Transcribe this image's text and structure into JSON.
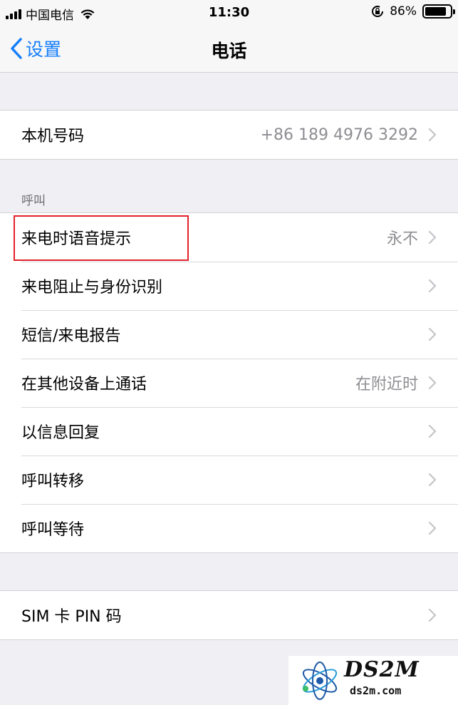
{
  "status_bar": {
    "carrier": "中国电信",
    "time": "11:30",
    "battery_percent": "86%",
    "battery_level": 0.86,
    "icons": [
      "signal-icon",
      "wifi-icon",
      "rotation-lock-icon",
      "battery-icon"
    ]
  },
  "nav": {
    "back_label": "设置",
    "title": "电话"
  },
  "my_number": {
    "label": "本机号码",
    "value": "+86 189 4976 3292"
  },
  "calls_section": {
    "header": "呼叫",
    "items": [
      {
        "label": "来电时语音提示",
        "value": "永不"
      },
      {
        "label": "来电阻止与身份识别",
        "value": ""
      },
      {
        "label": "短信/来电报告",
        "value": ""
      },
      {
        "label": "在其他设备上通话",
        "value": "在附近时"
      },
      {
        "label": "以信息回复",
        "value": ""
      },
      {
        "label": "呼叫转移",
        "value": ""
      },
      {
        "label": "呼叫等待",
        "value": ""
      }
    ]
  },
  "sim_section": {
    "label": "SIM 卡 PIN 码"
  },
  "watermark": {
    "title": "DS2M",
    "url": "ds2m.com"
  },
  "colors": {
    "accent": "#147efb",
    "background": "#efeff4",
    "highlight": "#e2222a"
  }
}
